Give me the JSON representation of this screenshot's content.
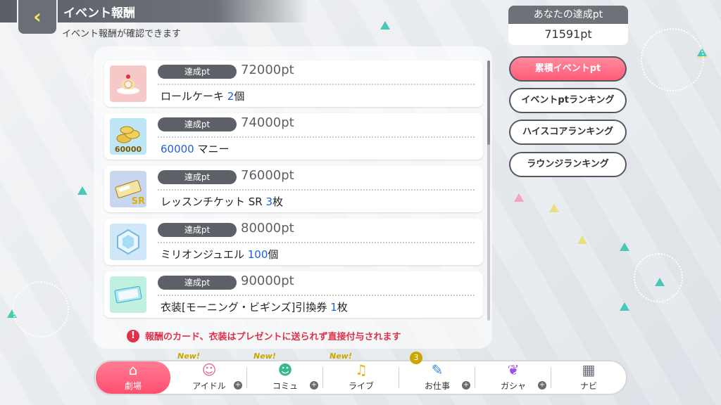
{
  "header": {
    "title": "イベント報酬",
    "subtitle": "イベント報酬が確認できます"
  },
  "points": {
    "label": "あなたの達成pt",
    "value": "71591pt"
  },
  "side_buttons": [
    {
      "label": "累積イベントpt",
      "active": true
    },
    {
      "label": "イベントptランキング",
      "active": false
    },
    {
      "label": "ハイスコアランキング",
      "active": false
    },
    {
      "label": "ラウンジランキング",
      "active": false
    }
  ],
  "rewards": [
    {
      "pill": "達成pt",
      "pt": "72000pt",
      "name": "ロールケーキ",
      "num": "2",
      "unit": "個",
      "icon": "cake-icon"
    },
    {
      "pill": "達成pt",
      "pt": "74000pt",
      "name_prefix": "60000",
      "name": " マニー",
      "icon": "money-icon",
      "icon_text": "60000"
    },
    {
      "pill": "達成pt",
      "pt": "76000pt",
      "name": "レッスンチケット SR",
      "num": "3",
      "unit": "枚",
      "icon": "ticket-icon",
      "icon_text": "SR"
    },
    {
      "pill": "達成pt",
      "pt": "80000pt",
      "name": "ミリオンジュエル",
      "num": "100",
      "unit": "個",
      "icon": "jewel-icon"
    },
    {
      "pill": "達成pt",
      "pt": "90000pt",
      "name": "衣装[モーニング・ビギンズ]引換券",
      "num": "1",
      "unit": "枚",
      "icon": "costume-ticket-icon"
    }
  ],
  "notice": "報酬のカード、衣装はプレゼントに送られず直接付与されます",
  "nav": [
    {
      "label": "劇場",
      "active": true
    },
    {
      "label": "アイドル",
      "tag": "New!"
    },
    {
      "label": "コミュ",
      "tag": "New!"
    },
    {
      "label": "ライブ",
      "tag": "New!"
    },
    {
      "label": "お仕事",
      "badge": "3"
    },
    {
      "label": "ガシャ"
    },
    {
      "label": "ナビ"
    }
  ]
}
